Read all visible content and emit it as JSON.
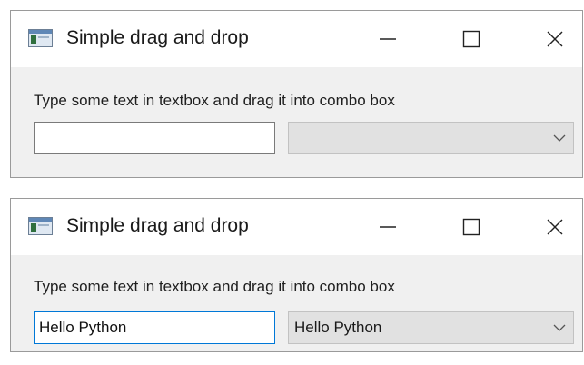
{
  "windows": [
    {
      "title": "Simple drag and drop",
      "hint": "Type some text in textbox and drag it into combo box",
      "textbox_value": "",
      "combo_value": ""
    },
    {
      "title": "Simple drag and drop",
      "hint": "Type some text in textbox and drag it into combo box",
      "textbox_value": "Hello Python",
      "combo_value": "Hello Python"
    }
  ],
  "icons": {
    "app": "app-window-icon",
    "minimize": "minimize-icon",
    "maximize": "maximize-icon",
    "close": "close-icon",
    "dropdown": "chevron-down-icon"
  },
  "colors": {
    "focus_border": "#0078d7",
    "window_bg": "#f0f0f0",
    "combo_bg": "#e1e1e1"
  }
}
